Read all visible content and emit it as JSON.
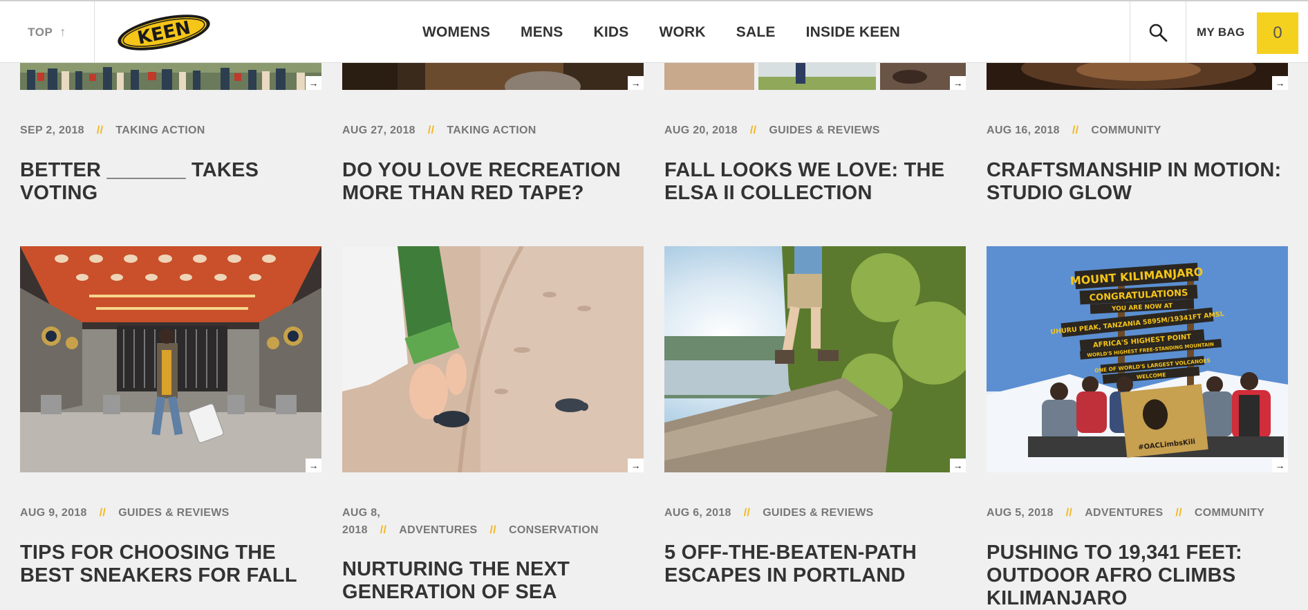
{
  "header": {
    "top_label": "TOP",
    "logo_text": "KEEN",
    "nav": [
      "WOMENS",
      "MENS",
      "KIDS",
      "WORK",
      "SALE",
      "INSIDE KEEN"
    ],
    "bag_label": "MY BAG",
    "bag_count": "0",
    "colors": {
      "accent": "#f5d11f",
      "separator": "#f1b71c"
    }
  },
  "row1": [
    {
      "date": "SEP 2, 2018",
      "categories": [
        "TAKING ACTION"
      ],
      "title": "BETTER _______ TAKES VOTING"
    },
    {
      "date": "AUG 27, 2018",
      "categories": [
        "TAKING ACTION"
      ],
      "title": "DO YOU LOVE RECREATION MORE THAN RED TAPE?"
    },
    {
      "date": "AUG 20, 2018",
      "categories": [
        "GUIDES & REVIEWS"
      ],
      "title": "FALL LOOKS WE LOVE: THE ELSA II COLLECTION"
    },
    {
      "date": "AUG 16, 2018",
      "categories": [
        "COMMUNITY"
      ],
      "title": "CRAFTSMANSHIP IN MOTION: STUDIO GLOW"
    }
  ],
  "row2": [
    {
      "date": "AUG 9, 2018",
      "categories": [
        "GUIDES & REVIEWS"
      ],
      "title": "TIPS FOR CHOOSING THE BEST SNEAKERS FOR FALL"
    },
    {
      "date": "AUG 8, 2018",
      "categories": [
        "ADVENTURES",
        "CONSERVATION"
      ],
      "title": "NURTURING THE NEXT GENERATION OF SEA"
    },
    {
      "date": "AUG 6, 2018",
      "categories": [
        "GUIDES & REVIEWS"
      ],
      "title": "5 OFF-THE-BEATEN-PATH ESCAPES IN PORTLAND"
    },
    {
      "date": "AUG 5, 2018",
      "categories": [
        "ADVENTURES",
        "COMMUNITY"
      ],
      "title": "PUSHING TO 19,341 FEET: OUTDOOR AFRO CLIMBS KILIMANJARO"
    }
  ],
  "kilimanjaro_sign": {
    "line1": "MOUNT KILIMANJARO",
    "line2": "CONGRATULATIONS",
    "line3": "YOU ARE NOW AT",
    "line4": "UHURU PEAK, TANZANIA 5895M/19341FT AMSL",
    "line5": "AFRICA'S HIGHEST POINT",
    "line6": "WORLD'S HIGHEST FREE-STANDING MOUNTAIN",
    "line7": "ONE OF WORLD'S LARGEST VOLCANOES",
    "line8": "WELCOME",
    "banner": "#OACLimbsKili"
  }
}
